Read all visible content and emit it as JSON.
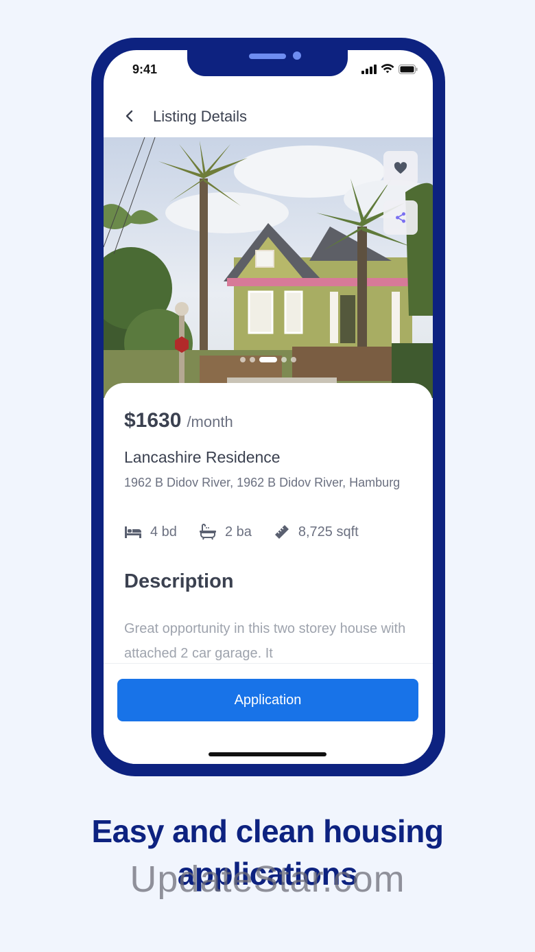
{
  "status_bar": {
    "time": "9:41"
  },
  "header": {
    "title": "Listing Details"
  },
  "listing": {
    "price": "$1630",
    "period": "/month",
    "name": "Lancashire Residence",
    "address": "1962 B Didov River, 1962 B Didov River, Hamburg",
    "features": [
      {
        "icon": "bed-icon",
        "label": "4 bd"
      },
      {
        "icon": "bathtub-icon",
        "label": "2 ba"
      },
      {
        "icon": "ruler-icon",
        "label": "8,725 sqft"
      }
    ],
    "description_title": "Description",
    "description": "Great opportunity in this two storey house with attached 2 car garage. It"
  },
  "gallery": {
    "slide_count": 5,
    "active_slide": 3
  },
  "actions": {
    "apply_label": "Application"
  },
  "tagline": "Easy and clean housing applications",
  "watermark": "UpdateStar.com",
  "colors": {
    "frame": "#0d2280",
    "primary_button": "#1873e8",
    "background": "#f1f5fd",
    "share_icon": "#7a6ff0"
  }
}
